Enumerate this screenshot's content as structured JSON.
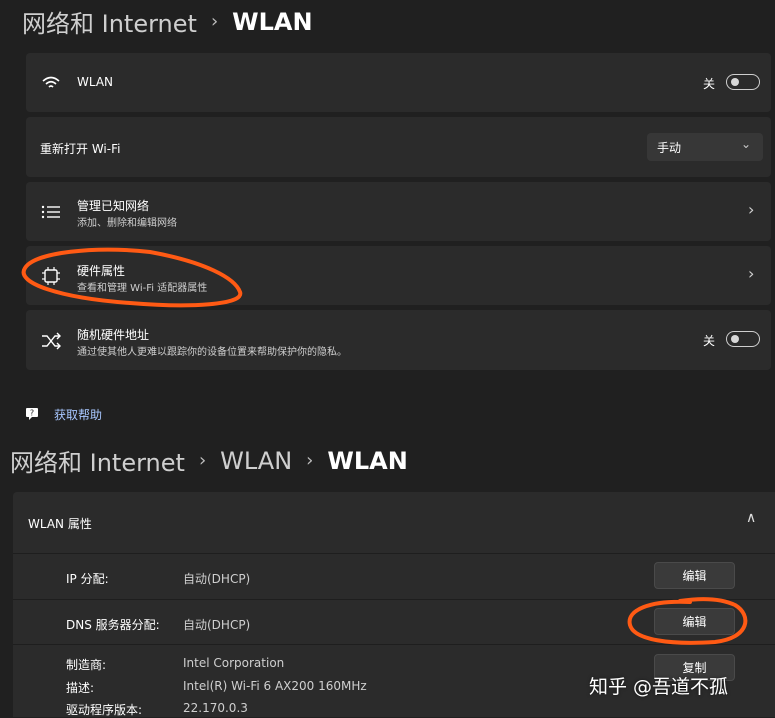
{
  "top": {
    "breadcrumb": {
      "parent": "网络和 Internet",
      "current": "WLAN"
    },
    "wlan_row": {
      "label": "WLAN",
      "state": "关",
      "icon": "wifi-icon"
    },
    "reopen_row": {
      "label": "重新打开 Wi-Fi",
      "dropdown_value": "手动"
    },
    "known_networks": {
      "title": "管理已知网络",
      "subtitle": "添加、删除和编辑网络",
      "icon": "list-icon"
    },
    "hardware": {
      "title": "硬件属性",
      "subtitle": "查看和管理 Wi-Fi 适配器属性",
      "icon": "chip-icon"
    },
    "random_mac": {
      "title": "随机硬件地址",
      "subtitle": "通过使其他人更难以跟踪你的设备位置来帮助保护你的隐私。",
      "state": "关",
      "icon": "shuffle-icon"
    },
    "help": {
      "label": "获取帮助",
      "icon": "help-icon"
    }
  },
  "bottom": {
    "breadcrumb": {
      "parent": "网络和 Internet",
      "middle": "WLAN",
      "current": "WLAN"
    },
    "section_title": "WLAN 属性",
    "rows": [
      {
        "label": "IP 分配:",
        "value": "自动(DHCP)",
        "button": "编辑"
      },
      {
        "label": "DNS 服务器分配:",
        "value": "自动(DHCP)",
        "button": "编辑"
      }
    ],
    "details": [
      {
        "label": "制造商:",
        "value": "Intel Corporation"
      },
      {
        "label": "描述:",
        "value": "Intel(R) Wi-Fi 6 AX200 160MHz"
      },
      {
        "label": "驱动程序版本:",
        "value": "22.170.0.3"
      }
    ],
    "copy_button": "复制"
  },
  "watermark": "知乎 @吾道不孤",
  "colors": {
    "annotation": "#ff5a14",
    "card": "#2b2b2b",
    "background": "#202020"
  }
}
